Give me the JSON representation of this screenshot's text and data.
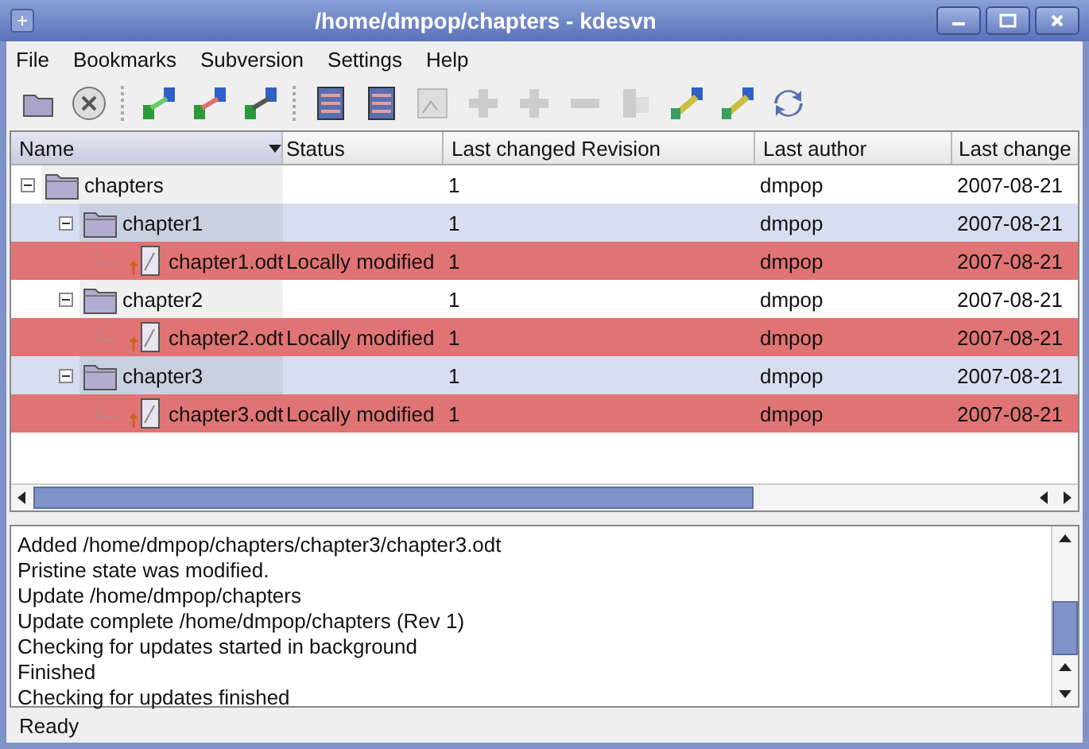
{
  "window": {
    "title": "/home/dmpop/chapters - kdesvn"
  },
  "menu": [
    {
      "label": "File"
    },
    {
      "label": "Bookmarks"
    },
    {
      "label": "Subversion"
    },
    {
      "label": "Settings"
    },
    {
      "label": "Help"
    }
  ],
  "table": {
    "columns": [
      "Name",
      "Status",
      "Last changed Revision",
      "Last author",
      "Last change"
    ],
    "rows": [
      {
        "kind": "folder",
        "name": "chapters",
        "revision": "1",
        "author": "dmpop",
        "date": "2007-08-21",
        "selected": false,
        "modified": false,
        "expanded": true,
        "children": [
          {
            "kind": "folder",
            "name": "chapter1",
            "revision": "1",
            "author": "dmpop",
            "date": "2007-08-21",
            "selected": true,
            "modified": false,
            "expanded": true,
            "children": [
              {
                "kind": "file",
                "name": "chapter1.odt",
                "status": "Locally modified",
                "revision": "1",
                "author": "dmpop",
                "date": "2007-08-21",
                "selected": false,
                "modified": true
              }
            ]
          },
          {
            "kind": "folder",
            "name": "chapter2",
            "revision": "1",
            "author": "dmpop",
            "date": "2007-08-21",
            "selected": false,
            "modified": false,
            "expanded": true,
            "children": [
              {
                "kind": "file",
                "name": "chapter2.odt",
                "status": "Locally modified",
                "revision": "1",
                "author": "dmpop",
                "date": "2007-08-21",
                "selected": false,
                "modified": true
              }
            ]
          },
          {
            "kind": "folder",
            "name": "chapter3",
            "revision": "1",
            "author": "dmpop",
            "date": "2007-08-21",
            "selected": true,
            "modified": false,
            "expanded": true,
            "children": [
              {
                "kind": "file",
                "name": "chapter3.odt",
                "status": "Locally modified",
                "revision": "1",
                "author": "dmpop",
                "date": "2007-08-21",
                "selected": false,
                "modified": true
              }
            ]
          }
        ]
      }
    ]
  },
  "log": [
    "Added /home/dmpop/chapters/chapter3/chapter3.odt",
    "Pristine state was modified.",
    "Update /home/dmpop/chapters",
    "Update complete /home/dmpop/chapters (Rev 1)",
    "Checking for updates started in background",
    "Finished",
    "Checking for updates finished"
  ],
  "status_bar": "Ready"
}
